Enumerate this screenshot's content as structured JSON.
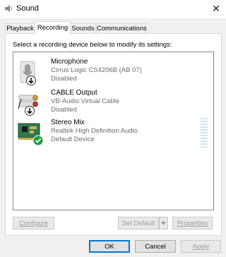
{
  "window": {
    "title": "Sound",
    "close_glyph": "✕",
    "icon": "speaker-icon"
  },
  "tabs": [
    {
      "label": "Playback",
      "active": false
    },
    {
      "label": "Recording",
      "active": true
    },
    {
      "label": "Sounds",
      "active": false
    },
    {
      "label": "Communications",
      "active": false
    }
  ],
  "instruction": "Select a recording device below to modify its settings:",
  "devices": [
    {
      "name": "Microphone",
      "driver": "Cirrus Logic CS4206B (AB 07)",
      "status": "Disabled",
      "icon": "microphone-icon",
      "badge": "disabled-arrow-icon"
    },
    {
      "name": "CABLE Output",
      "driver": "VB-Audio Virtual Cable",
      "status": "Disabled",
      "icon": "audio-jack-icon",
      "badge": "disabled-arrow-icon"
    },
    {
      "name": "Stereo Mix",
      "driver": "Realtek High Definition Audio",
      "status": "Default Device",
      "icon": "sound-card-icon",
      "badge": "default-check-icon"
    }
  ],
  "buttons": {
    "configure": "Configure",
    "set_default": "Set Default",
    "properties": "Properties",
    "ok": "OK",
    "cancel": "Cancel",
    "apply": "Apply"
  },
  "colors": {
    "accent": "#0078d7",
    "check_green": "#1e9e3c"
  }
}
